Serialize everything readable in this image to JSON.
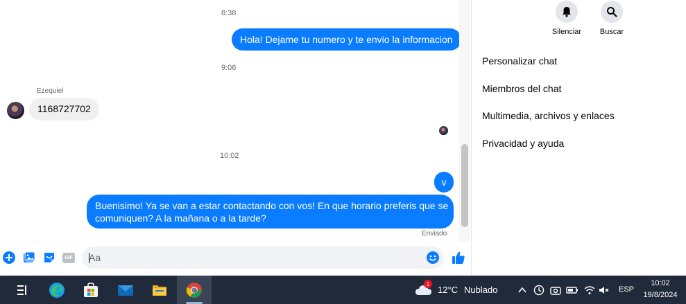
{
  "chat": {
    "messages": [
      {
        "type": "time",
        "text": "8:38"
      },
      {
        "type": "outgoing",
        "text": "Hola! Dejame tu numero y te envio la informacion"
      },
      {
        "type": "time",
        "text": "9:06"
      },
      {
        "type": "incoming",
        "sender": "Ezequiel",
        "text": "1168727702"
      },
      {
        "type": "time",
        "text": "10:02"
      },
      {
        "type": "outgoing",
        "text": "v"
      },
      {
        "type": "outgoing",
        "lines": [
          "Buenisimo! Ya se van a estar contactando con vos! En que horario preferis que se",
          "comuniquen? A la mañana o a la tarde?"
        ]
      }
    ],
    "status": "Enviado"
  },
  "composer": {
    "placeholder": "Aa",
    "value": "",
    "icons": [
      "plus-circle-icon",
      "image-icon",
      "sticker-icon",
      "gif-icon",
      "emoji-icon",
      "like-icon"
    ],
    "gif_label": "GIF"
  },
  "info_panel": {
    "actions": [
      {
        "label": "Silenciar",
        "icon": "bell-icon"
      },
      {
        "label": "Buscar",
        "icon": "search-icon"
      }
    ],
    "menu": [
      "Personalizar chat",
      "Miembros del chat",
      "Multimedia, archivos y enlaces",
      "Privacidad y ayuda"
    ]
  },
  "taskbar": {
    "apps": [
      "task-view-icon",
      "edge-icon",
      "store-icon",
      "mail-icon",
      "file-explorer-icon",
      "chrome-icon"
    ],
    "weather": {
      "badge": "1",
      "temp": "12°C",
      "condition": "Nublado"
    },
    "language": "ESP",
    "time": "10:02",
    "date": "19/8/2024"
  },
  "colors": {
    "accent": "#0a7cff",
    "bubble_in": "#f0f0f0",
    "taskbar": "#202a3a"
  }
}
